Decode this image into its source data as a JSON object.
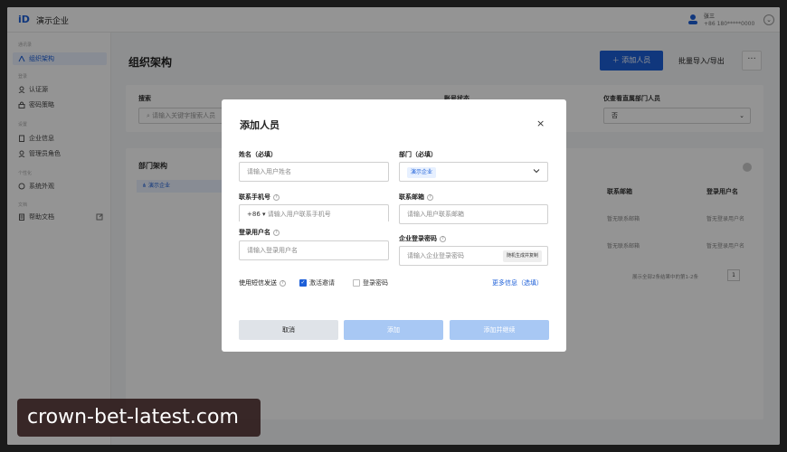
{
  "topbar": {
    "org_name": "演示企业",
    "user_name": "张三",
    "user_phone": "+86 180*****0000"
  },
  "sidebar": {
    "groups": [
      "通讯录",
      "登录",
      "设置",
      "个性化",
      "文档"
    ],
    "items": [
      {
        "label": "组织架构",
        "icon": "org-icon",
        "active": true
      },
      {
        "label": "认证源",
        "icon": "user-icon"
      },
      {
        "label": "密码策略",
        "icon": "lock-icon"
      },
      {
        "label": "企业信息",
        "icon": "building-icon"
      },
      {
        "label": "管理员角色",
        "icon": "admin-icon"
      },
      {
        "label": "系统外观",
        "icon": "palette-icon"
      },
      {
        "label": "帮助文档",
        "icon": "doc-icon"
      }
    ]
  },
  "main": {
    "title": "组织架构",
    "add_member": "添加人员",
    "bulk": "批量导入/导出",
    "more": "···",
    "search_label": "搜索",
    "search_placeholder": "请输入关键字搜索人员",
    "status_label": "账号状态",
    "direct_label": "仅查看直属部门人员",
    "direct_value": "否",
    "dept_title": "部门架构",
    "dept_root": "演示企业",
    "columns": [
      "联系邮箱",
      "登录用户名"
    ],
    "rows": [
      [
        "暂无联系邮箱",
        "暂无登录用户名"
      ],
      [
        "暂无联系邮箱",
        "暂无登录用户名"
      ]
    ],
    "pagination_text": "展示全部2条结果中的第1-2条",
    "page": "1"
  },
  "modal": {
    "title": "添加人员",
    "close": "×",
    "name_label": "姓名（必填）",
    "name_placeholder": "请输入用户姓名",
    "dept_label": "部门（必填）",
    "dept_value": "演示企业",
    "phone_label": "联系手机号",
    "phone_prefix": "+86",
    "phone_placeholder": "请输入用户联系手机号",
    "email_label": "联系邮箱",
    "email_placeholder": "请输入用户联系邮箱",
    "username_label": "登录用户名",
    "username_placeholder": "请输入登录用户名",
    "password_label": "企业登录密码",
    "password_placeholder": "请输入企业登录密码",
    "generate_label": "随机生成并复制",
    "sms_label": "使用短信发送",
    "activate_label": "激活邀请",
    "login_pw_label": "登录密码",
    "more_info": "更多信息（选填）",
    "cancel": "取消",
    "add": "添加",
    "add_continue": "添加并继续"
  },
  "watermark": "crown-bet-latest.com",
  "colors": {
    "primary": "#1d5fd8",
    "primary_disabled": "#a8c8f4"
  }
}
